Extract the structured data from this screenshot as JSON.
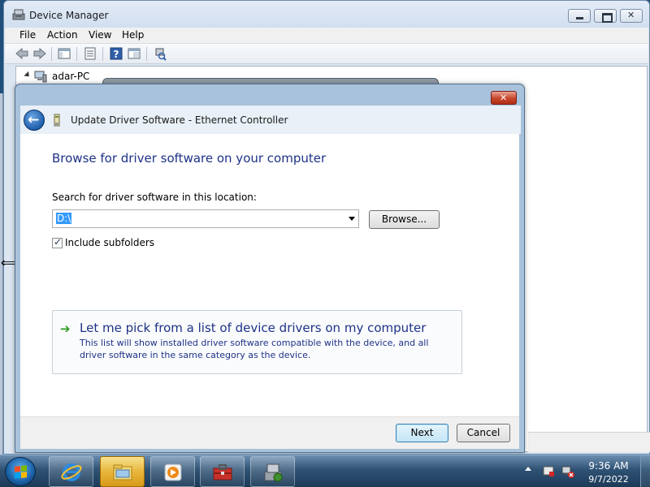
{
  "device_manager": {
    "title": "Device Manager",
    "menu": [
      "File",
      "Action",
      "View",
      "Help"
    ],
    "tree_root": "adar-PC"
  },
  "wizard": {
    "header_title": "Update Driver Software - Ethernet Controller",
    "heading": "Browse for driver software on your computer",
    "search_label": "Search for driver software in this location:",
    "path_value": "D:\\",
    "browse_label": "Browse...",
    "include_subfolders_label": "Include subfolders",
    "include_subfolders_checked": true,
    "pick_title": "Let me pick from a list of device drivers on my computer",
    "pick_description": "This list will show installed driver software compatible with the device, and all driver software in the same category as the device.",
    "next_label": "Next",
    "cancel_label": "Cancel"
  },
  "taskbar": {
    "apps": [
      "internet-explorer-icon",
      "windows-explorer-icon",
      "media-player-icon",
      "toolbox-icon",
      "device-manager-icon"
    ],
    "time": "9:36 AM",
    "date": "9/7/2022"
  },
  "colors": {
    "heading_blue": "#1e3287",
    "selection_blue": "#3399ff",
    "link_arrow_green": "#2e9a24"
  }
}
